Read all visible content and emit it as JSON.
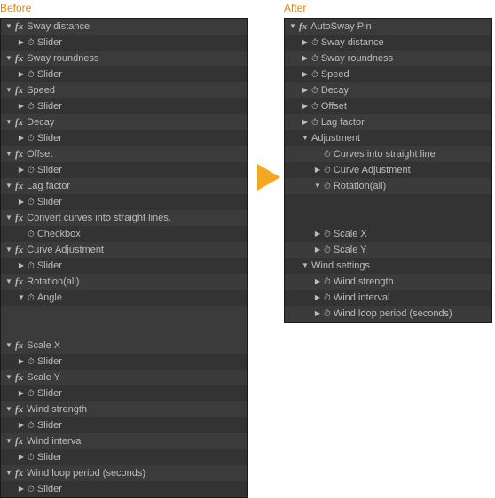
{
  "headings": {
    "before": "Before",
    "after": "After"
  },
  "before": {
    "effects": [
      {
        "name": "Sway distance",
        "props": [
          {
            "name": "Slider",
            "hasSw": true
          }
        ]
      },
      {
        "name": "Sway roundness",
        "props": [
          {
            "name": "Slider",
            "hasSw": true
          }
        ]
      },
      {
        "name": "Speed",
        "props": [
          {
            "name": "Slider",
            "hasSw": true
          }
        ]
      },
      {
        "name": "Decay",
        "props": [
          {
            "name": "Slider",
            "hasSw": true
          }
        ]
      },
      {
        "name": "Offset",
        "props": [
          {
            "name": "Slider",
            "hasSw": true
          }
        ]
      },
      {
        "name": "Lag factor",
        "props": [
          {
            "name": "Slider",
            "hasSw": true
          }
        ]
      },
      {
        "name": "Convert curves into straight lines.",
        "props": [
          {
            "name": "Checkbox",
            "hasSw": true,
            "noTri": true
          }
        ]
      },
      {
        "name": "Curve Adjustment",
        "props": [
          {
            "name": "Slider",
            "hasSw": true
          }
        ]
      },
      {
        "name": "Rotation(all)",
        "props": [
          {
            "name": "Angle",
            "hasSw": true,
            "triDown": true,
            "gapAfter": true
          }
        ]
      },
      {
        "name": "Scale X",
        "props": [
          {
            "name": "Slider",
            "hasSw": true
          }
        ]
      },
      {
        "name": "Scale Y",
        "props": [
          {
            "name": "Slider",
            "hasSw": true
          }
        ]
      },
      {
        "name": "Wind strength",
        "props": [
          {
            "name": "Slider",
            "hasSw": true
          }
        ]
      },
      {
        "name": "Wind interval",
        "props": [
          {
            "name": "Slider",
            "hasSw": true
          }
        ]
      },
      {
        "name": "Wind loop period (seconds)",
        "props": [
          {
            "name": "Slider",
            "hasSw": true
          }
        ]
      }
    ]
  },
  "after": {
    "effect": {
      "name": "AutoSway Pin"
    },
    "top": [
      {
        "name": "Sway distance"
      },
      {
        "name": "Sway roundness"
      },
      {
        "name": "Speed"
      },
      {
        "name": "Decay"
      },
      {
        "name": "Offset"
      },
      {
        "name": "Lag factor"
      }
    ],
    "adjustment": {
      "label": "Adjustment",
      "items": [
        {
          "name": "Curves into straight line",
          "noTri": true
        },
        {
          "name": "Curve Adjustment"
        },
        {
          "name": "Rotation(all)",
          "triDown": true,
          "gapAfter": true
        },
        {
          "name": "Scale X"
        },
        {
          "name": "Scale Y"
        }
      ]
    },
    "wind": {
      "label": "Wind settings",
      "items": [
        {
          "name": "Wind strength"
        },
        {
          "name": "Wind interval"
        },
        {
          "name": "Wind loop period (seconds)"
        }
      ]
    }
  }
}
